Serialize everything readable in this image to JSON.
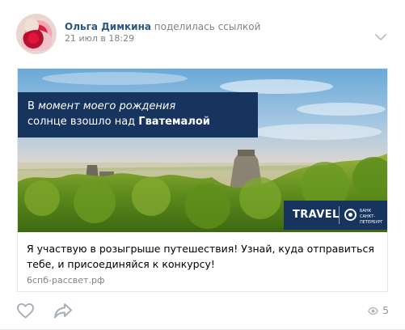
{
  "post": {
    "author_name": "Ольга Димкина",
    "author_action": "поделилась ссылкой",
    "date": "21 июл в 18:29",
    "views_count": "5"
  },
  "card": {
    "headline_line1_prefix": "В ",
    "headline_line1_italic": "момент моего рождения",
    "headline_line2_prefix": "солнце взошло над ",
    "headline_line2_bold": "Гватемалой",
    "badge_travel": "TRAVEL",
    "bank_name_line1": "БАНК",
    "bank_name_line2": "САНКТ-",
    "bank_name_line3": "ПЕТЕРБУРГ",
    "text": "Я участвую в розыгрыше путешествия! Узнай, куда отправиться тебе, и присоединяйся к конкурсу!",
    "domain": "6спб-рассвет.рф"
  },
  "colors": {
    "link": "#2a5885",
    "muted": "#828282",
    "navy": "#17345f",
    "icon": "#939393"
  },
  "icons": {
    "menu": "chevron-down-icon",
    "like": "heart-icon",
    "share": "share-arrow-icon",
    "views": "eye-icon",
    "bank": "bank-logo-icon"
  }
}
